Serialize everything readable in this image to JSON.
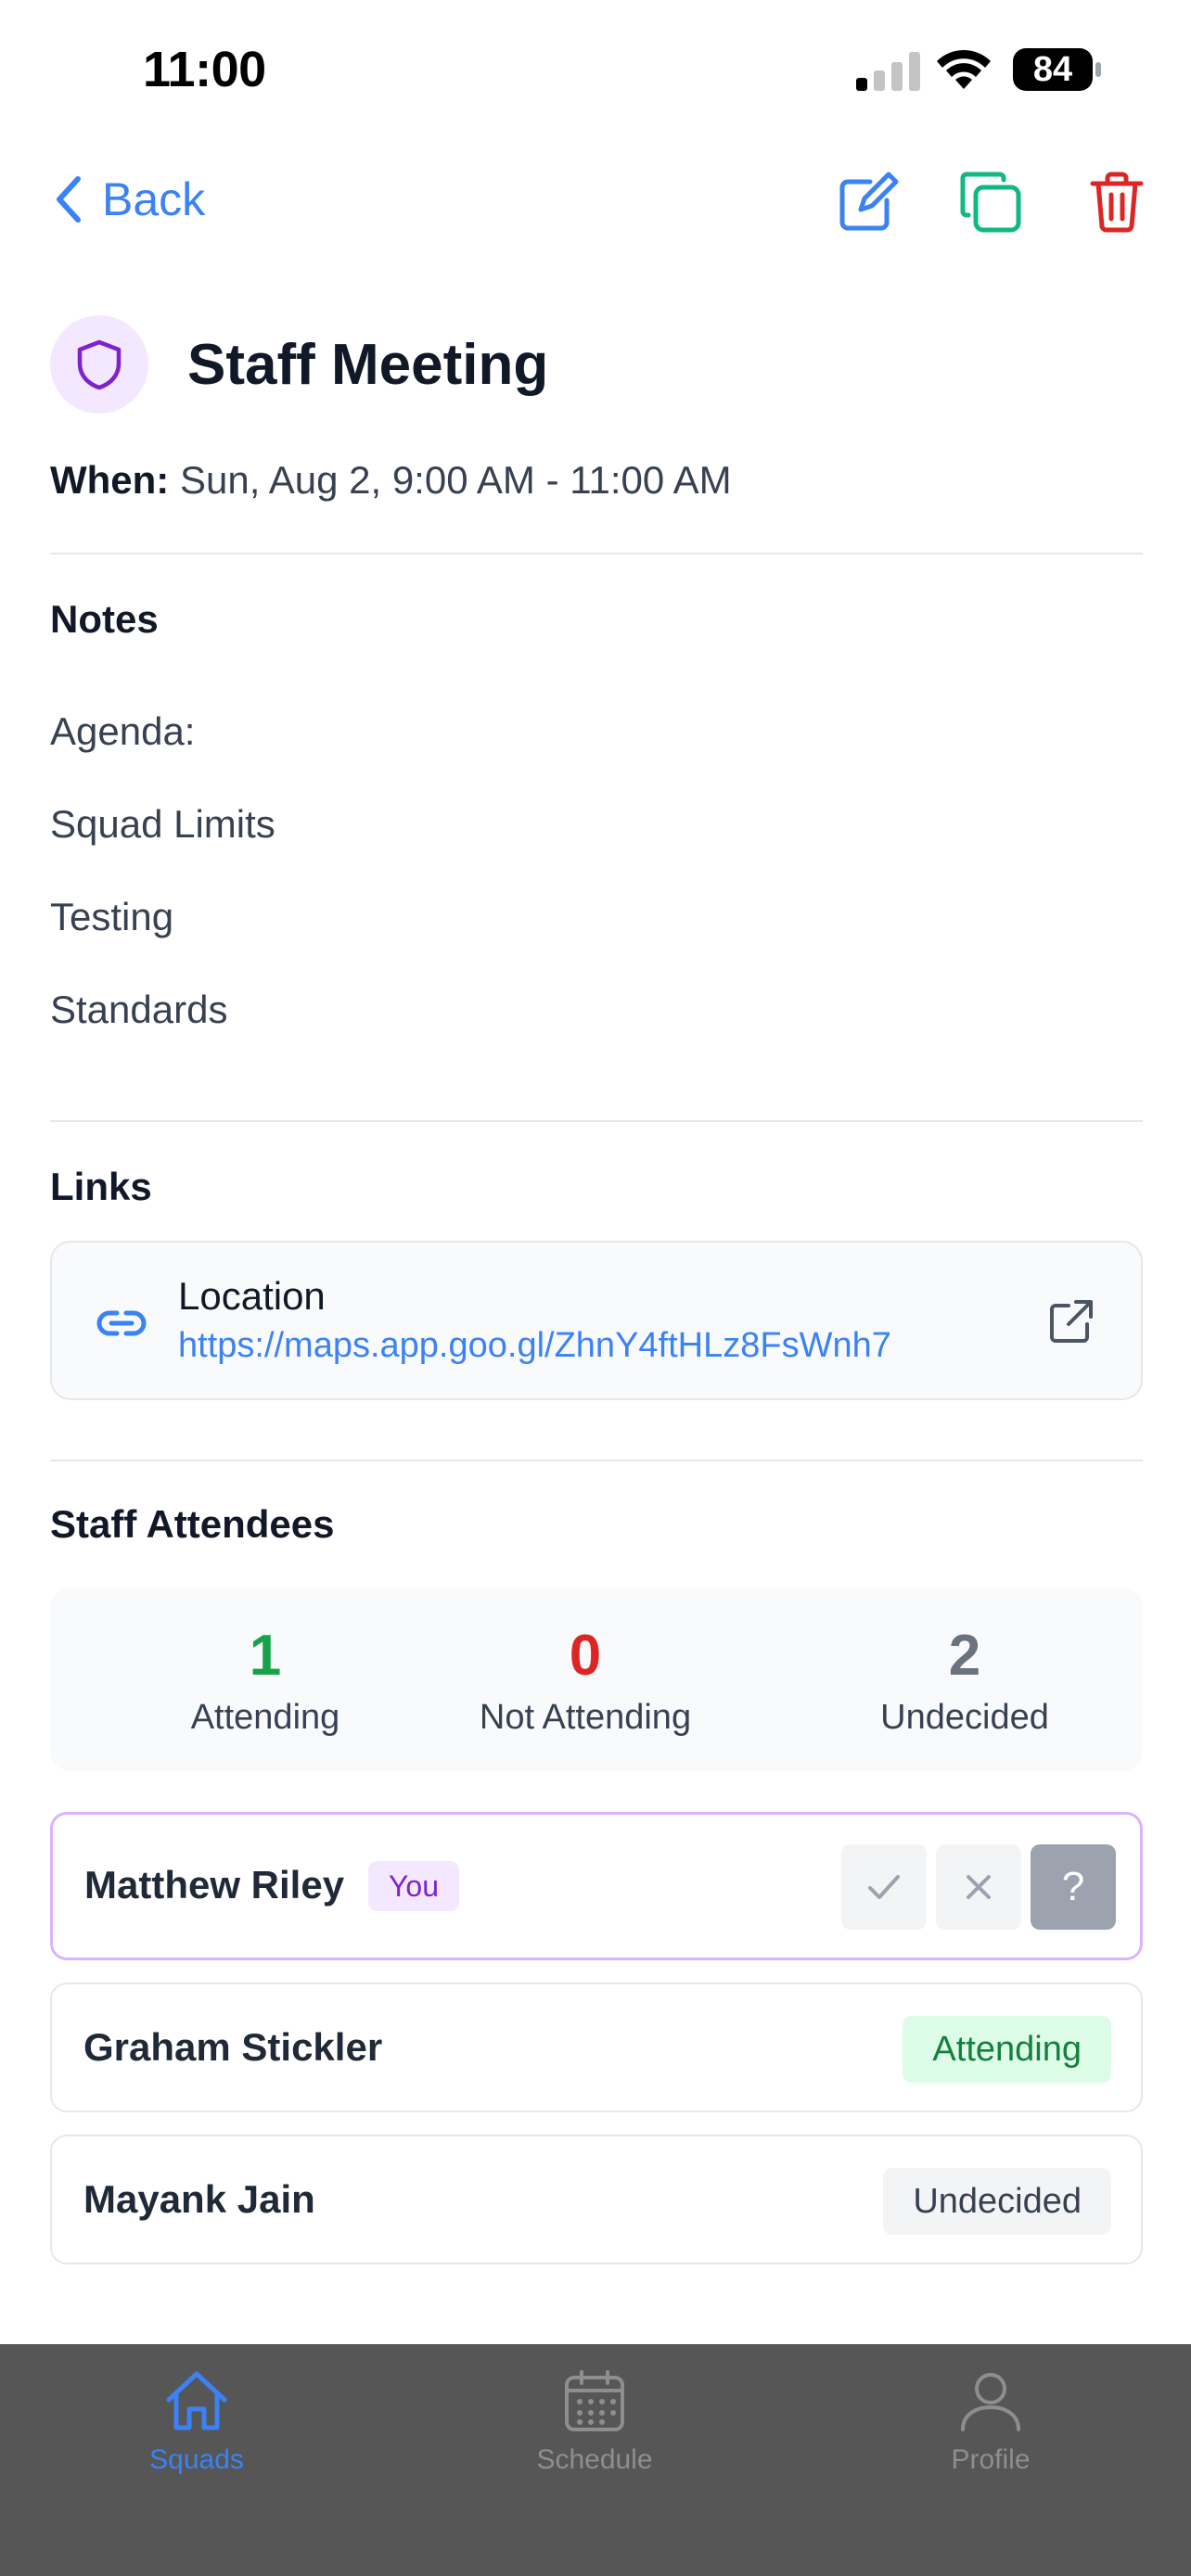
{
  "status_bar": {
    "time": "11:00",
    "battery": "84"
  },
  "nav": {
    "back_label": "Back"
  },
  "event": {
    "title": "Staff Meeting",
    "when_label": "When:",
    "when_value": "Sun, Aug 2, 9:00 AM - 11:00 AM"
  },
  "notes": {
    "title": "Notes",
    "lines": [
      "Agenda:",
      "Squad Limits",
      "Testing",
      "Standards"
    ]
  },
  "links": {
    "title": "Links",
    "items": [
      {
        "name": "Location",
        "url": "https://maps.app.goo.gl/ZhnY4ftHLz8FsWnh7"
      }
    ]
  },
  "attendees": {
    "title": "Staff Attendees",
    "summary": [
      {
        "count": "1",
        "label": "Attending"
      },
      {
        "count": "0",
        "label": "Not Attending"
      },
      {
        "count": "2",
        "label": "Undecided"
      }
    ],
    "rows": [
      {
        "name": "Matthew Riley",
        "badge": "You",
        "rsvp_maybe": "?"
      },
      {
        "name": "Graham Stickler",
        "status": "Attending"
      },
      {
        "name": "Mayank Jain",
        "status": "Undecided"
      }
    ]
  },
  "tabs": [
    {
      "label": "Squads",
      "icon": "home-icon",
      "active": true
    },
    {
      "label": "Schedule",
      "icon": "calendar-icon",
      "active": false
    },
    {
      "label": "Profile",
      "icon": "person-icon",
      "active": false
    }
  ],
  "colors": {
    "accent": "#3b82f6",
    "attending": "#16a34a",
    "not_attending": "#dc2626",
    "undecided": "#6b7280",
    "brand_purple": "#7e22ce",
    "tab_bar": "#565656"
  }
}
